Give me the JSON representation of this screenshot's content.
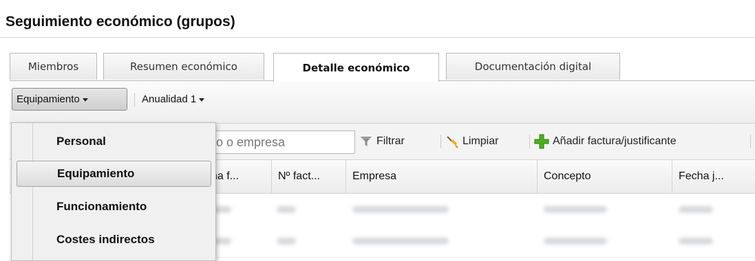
{
  "page": {
    "title": "Seguimiento económico (grupos)"
  },
  "tabs": [
    {
      "label": "Miembros"
    },
    {
      "label": "Resumen económico"
    },
    {
      "label": "Detalle económico",
      "active": true
    },
    {
      "label": "Documentación digital"
    }
  ],
  "toolbar": {
    "category_dropdown": "Equipamiento",
    "year_dropdown": "Anualidad 1"
  },
  "category_menu": {
    "items": [
      "Personal",
      "Equipamiento",
      "Funcionamiento",
      "Costes indirectos"
    ],
    "highlighted": "Equipamiento"
  },
  "search": {
    "placeholder": "Concepto o empresa",
    "visible_placeholder_fragment": "pto o empresa"
  },
  "actions": {
    "filter": "Filtrar",
    "clear": "Limpiar",
    "add": "Añadir factura/justificante"
  },
  "grid": {
    "columns": [
      "Fecha f...",
      "Nº fact...",
      "Empresa",
      "Concepto",
      "Fecha j..."
    ],
    "visible_header_fragment": "cha f..."
  },
  "icons": {
    "filter": "funnel-icon",
    "clear": "broom-icon",
    "add": "green-plus-icon"
  }
}
